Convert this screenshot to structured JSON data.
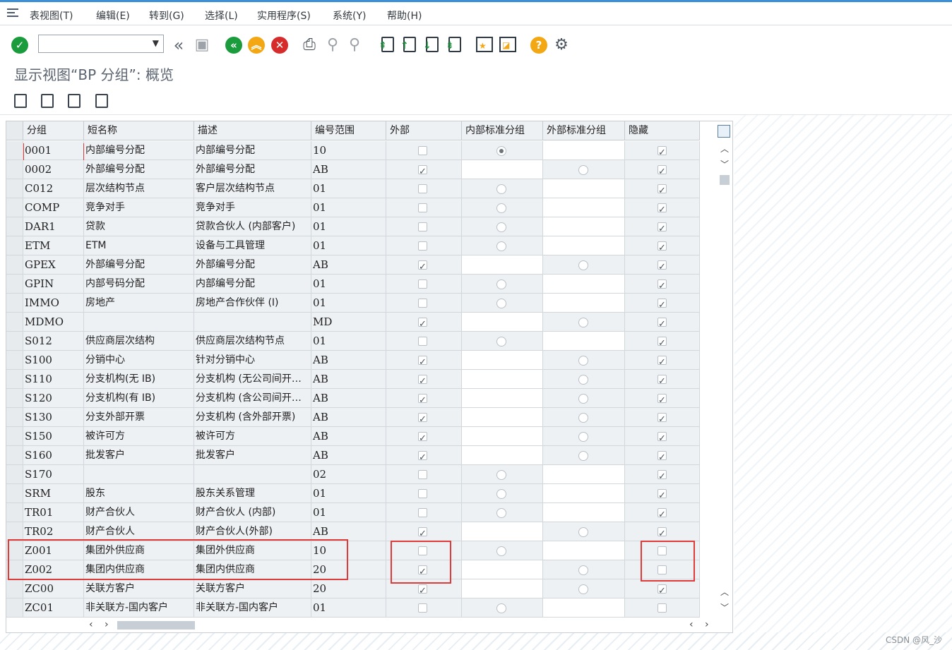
{
  "menu": [
    "表视图(T)",
    "编辑(E)",
    "转到(G)",
    "选择(L)",
    "实用程序(S)",
    "系统(Y)",
    "帮助(H)"
  ],
  "page_title": "显示视图“BP 分组”: 概览",
  "columns": [
    "分组",
    "短名称",
    "描述",
    "编号范围",
    "外部",
    "内部标准分组",
    "外部标准分组",
    "隐藏"
  ],
  "rows": [
    {
      "group": "0001",
      "short": "内部编号分配",
      "desc": "内部编号分配",
      "range": "10",
      "external": false,
      "int_std": "selected",
      "ext_std": "none",
      "hidden": true
    },
    {
      "group": "0002",
      "short": "外部编号分配",
      "desc": "外部编号分配",
      "range": "AB",
      "external": true,
      "int_std": "none",
      "ext_std": "empty",
      "hidden": true
    },
    {
      "group": "C012",
      "short": "层次结构节点",
      "desc": "客户层次结构节点",
      "range": "01",
      "external": false,
      "int_std": "empty",
      "ext_std": "none",
      "hidden": true
    },
    {
      "group": "COMP",
      "short": "竞争对手",
      "desc": "竞争对手",
      "range": "01",
      "external": false,
      "int_std": "empty",
      "ext_std": "none",
      "hidden": true
    },
    {
      "group": "DAR1",
      "short": "贷款",
      "desc": "贷款合伙人 (内部客户)",
      "range": "01",
      "external": false,
      "int_std": "empty",
      "ext_std": "none",
      "hidden": true
    },
    {
      "group": "ETM",
      "short": "ETM",
      "desc": "设备与工具管理",
      "range": "01",
      "external": false,
      "int_std": "empty",
      "ext_std": "none",
      "hidden": true
    },
    {
      "group": "GPEX",
      "short": "外部编号分配",
      "desc": "外部编号分配",
      "range": "AB",
      "external": true,
      "int_std": "none",
      "ext_std": "empty",
      "hidden": true
    },
    {
      "group": "GPIN",
      "short": "内部号码分配",
      "desc": "内部编号分配",
      "range": "01",
      "external": false,
      "int_std": "empty",
      "ext_std": "none",
      "hidden": true
    },
    {
      "group": "IMMO",
      "short": "房地产",
      "desc": "房地产合作伙伴 (I)",
      "range": "01",
      "external": false,
      "int_std": "empty",
      "ext_std": "none",
      "hidden": true
    },
    {
      "group": "MDMO",
      "short": "",
      "desc": "",
      "range": "MD",
      "external": true,
      "int_std": "none",
      "ext_std": "empty",
      "hidden": true
    },
    {
      "group": "S012",
      "short": "供应商层次结构",
      "desc": "供应商层次结构节点",
      "range": "01",
      "external": false,
      "int_std": "empty",
      "ext_std": "none",
      "hidden": true
    },
    {
      "group": "S100",
      "short": "分销中心",
      "desc": "针对分销中心",
      "range": "AB",
      "external": true,
      "int_std": "none",
      "ext_std": "empty",
      "hidden": true
    },
    {
      "group": "S110",
      "short": "分支机构(无 IB)",
      "desc": "分支机构 (无公司间开…",
      "range": "AB",
      "external": true,
      "int_std": "none",
      "ext_std": "empty",
      "hidden": true
    },
    {
      "group": "S120",
      "short": "分支机构(有 IB)",
      "desc": "分支机构 (含公司间开…",
      "range": "AB",
      "external": true,
      "int_std": "none",
      "ext_std": "empty",
      "hidden": true
    },
    {
      "group": "S130",
      "short": "分支外部开票",
      "desc": "分支机构 (含外部开票)",
      "range": "AB",
      "external": true,
      "int_std": "none",
      "ext_std": "empty",
      "hidden": true
    },
    {
      "group": "S150",
      "short": "被许可方",
      "desc": "被许可方",
      "range": "AB",
      "external": true,
      "int_std": "none",
      "ext_std": "empty",
      "hidden": true
    },
    {
      "group": "S160",
      "short": "批发客户",
      "desc": "批发客户",
      "range": "AB",
      "external": true,
      "int_std": "none",
      "ext_std": "empty",
      "hidden": true
    },
    {
      "group": "S170",
      "short": "",
      "desc": "",
      "range": "02",
      "external": false,
      "int_std": "empty",
      "ext_std": "none",
      "hidden": true
    },
    {
      "group": "SRM",
      "short": "股东",
      "desc": "股东关系管理",
      "range": "01",
      "external": false,
      "int_std": "empty",
      "ext_std": "none",
      "hidden": true
    },
    {
      "group": "TR01",
      "short": "财产合伙人",
      "desc": "财产合伙人 (内部)",
      "range": "01",
      "external": false,
      "int_std": "empty",
      "ext_std": "none",
      "hidden": true
    },
    {
      "group": "TR02",
      "short": "财产合伙人",
      "desc": "财产合伙人(外部)",
      "range": "AB",
      "external": true,
      "int_std": "none",
      "ext_std": "empty",
      "hidden": true
    },
    {
      "group": "Z001",
      "short": "集团外供应商",
      "desc": "集团外供应商",
      "range": "10",
      "external": false,
      "int_std": "empty",
      "ext_std": "none",
      "hidden": false
    },
    {
      "group": "Z002",
      "short": "集团内供应商",
      "desc": "集团内供应商",
      "range": "20",
      "external": true,
      "int_std": "none",
      "ext_std": "empty",
      "hidden": false
    },
    {
      "group": "ZC00",
      "short": "关联方客户",
      "desc": "关联方客户",
      "range": "20",
      "external": true,
      "int_std": "none",
      "ext_std": "empty",
      "hidden": true
    },
    {
      "group": "ZC01",
      "short": "非关联方-国内客户",
      "desc": "非关联方-国内客户",
      "range": "01",
      "external": false,
      "int_std": "empty",
      "ext_std": "none",
      "hidden": false
    }
  ],
  "watermark": "CSDN @风_沙",
  "colors": {
    "accent": "#3b8fd6",
    "ok_green": "#1a9b3c",
    "cancel_red": "#d62c2c",
    "exit_orange": "#f2a713",
    "highlight_red": "#e03b3b"
  }
}
